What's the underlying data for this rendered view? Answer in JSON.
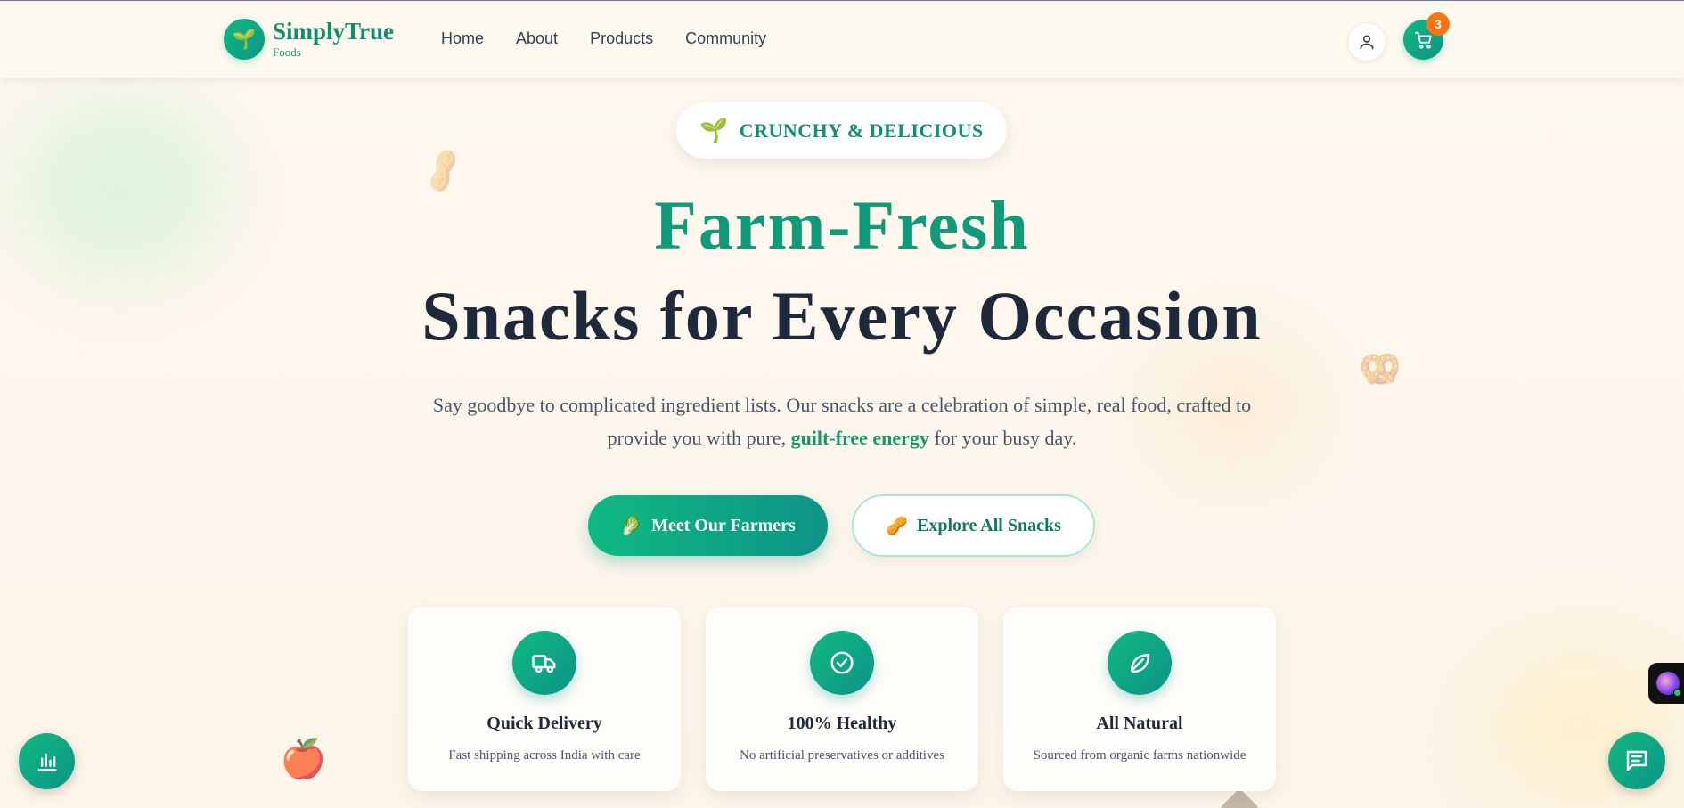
{
  "brand": {
    "name": "SimplyTrue",
    "sub": "Foods",
    "logo_icon": "🌱"
  },
  "nav": {
    "items": [
      {
        "label": "Home"
      },
      {
        "label": "About"
      },
      {
        "label": "Products"
      },
      {
        "label": "Community"
      }
    ]
  },
  "header": {
    "cart_count": "3"
  },
  "hero": {
    "pill_icon": "🌱",
    "pill_text": "CRUNCHY & DELICIOUS",
    "title_line1": "Farm-Fresh",
    "title_line2": "Snacks for Every Occasion",
    "desc_part1": "Say goodbye to complicated ingredient lists. Our snacks are a celebration of simple, real food, crafted to provide you with pure, ",
    "desc_highlight": "guilt-free energy",
    "desc_part2": " for your busy day.",
    "primary_button": {
      "icon": "🥬",
      "label": "Meet Our Farmers"
    },
    "secondary_button": {
      "icon": "🥜",
      "label": "Explore All Snacks"
    }
  },
  "features": [
    {
      "icon": "truck-icon",
      "title": "Quick Delivery",
      "desc": "Fast shipping across India with care"
    },
    {
      "icon": "check-circle-icon",
      "title": "100% Healthy",
      "desc": "No artificial preservatives or additives"
    },
    {
      "icon": "leaf-icon",
      "title": "All Natural",
      "desc": "Sourced from organic farms nationwide"
    }
  ],
  "decorations": {
    "peanut": "🥜",
    "pretzel": "🥨",
    "apple": "🍎"
  },
  "colors": {
    "brand_green": "#10b981",
    "brand_teal": "#0d9488",
    "badge_orange": "#f97316",
    "heading_dark": "#1e293b"
  }
}
